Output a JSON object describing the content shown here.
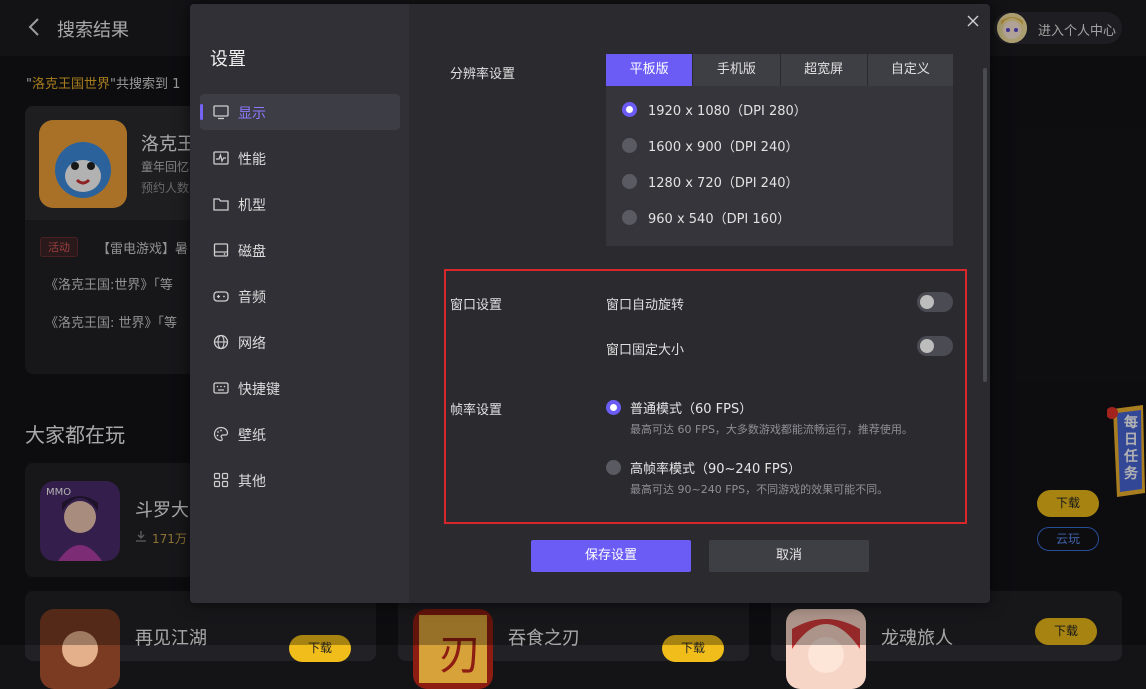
{
  "header": {
    "title": "搜索结果",
    "user_center_label": "进入个人中心"
  },
  "search": {
    "query": "洛克王国世界",
    "summary_prefix": "\"",
    "summary_suffix": "\"共搜索到 1"
  },
  "result": {
    "name": "洛克王",
    "subtitle": "童年回忆",
    "reservation": "预约人数",
    "activity_tag": "活动",
    "news": [
      "【雷电游戏】暑",
      "《洛克王国:世界》「等",
      "《洛克王国: 世界》「等"
    ]
  },
  "popular": {
    "title": "大家都在玩",
    "games": [
      {
        "name": "斗罗大",
        "downloads": "171万"
      },
      {
        "name": "再见江湖"
      },
      {
        "name": "吞食之刃"
      },
      {
        "name": "龙魂旅人"
      }
    ],
    "download_label": "下载",
    "cloud_label": "云玩"
  },
  "task_badge": {
    "text": "每日任务"
  },
  "settings": {
    "title": "设置",
    "nav": [
      {
        "label": "显示",
        "icon": "monitor-icon"
      },
      {
        "label": "性能",
        "icon": "activity-icon"
      },
      {
        "label": "机型",
        "icon": "folder-icon"
      },
      {
        "label": "磁盘",
        "icon": "disk-icon"
      },
      {
        "label": "音频",
        "icon": "gamepad-icon"
      },
      {
        "label": "网络",
        "icon": "globe-icon"
      },
      {
        "label": "快捷键",
        "icon": "keyboard-icon"
      },
      {
        "label": "壁纸",
        "icon": "palette-icon"
      },
      {
        "label": "其他",
        "icon": "grid-icon"
      }
    ],
    "active_nav": "显示",
    "resolution": {
      "label": "分辨率设置",
      "tabs": [
        "平板版",
        "手机版",
        "超宽屏",
        "自定义"
      ],
      "active_tab": "平板版",
      "options": [
        "1920 x 1080（DPI 280）",
        "1600 x 900（DPI 240）",
        "1280 x 720（DPI 240）",
        "960 x 540（DPI 160）"
      ],
      "selected_option": "1920 x 1080（DPI 280）"
    },
    "window": {
      "label": "窗口设置",
      "auto_rotate": "窗口自动旋转",
      "fixed_size": "窗口固定大小",
      "auto_rotate_on": false,
      "fixed_size_on": false
    },
    "frame_rate": {
      "label": "帧率设置",
      "options": [
        {
          "title": "普通模式（60 FPS）",
          "desc": "最高可达 60 FPS，大多数游戏都能流畅运行，推荐使用。"
        },
        {
          "title": "高帧率模式（90~240 FPS）",
          "desc": "最高可达 90~240 FPS，不同游戏的效果可能不同。"
        }
      ],
      "selected": "普通模式（60 FPS）"
    },
    "save_label": "保存设置",
    "cancel_label": "取消"
  },
  "colors": {
    "accent": "#6c5cf6",
    "highlight_box": "#d8262d",
    "download": "#f0bd1b"
  }
}
